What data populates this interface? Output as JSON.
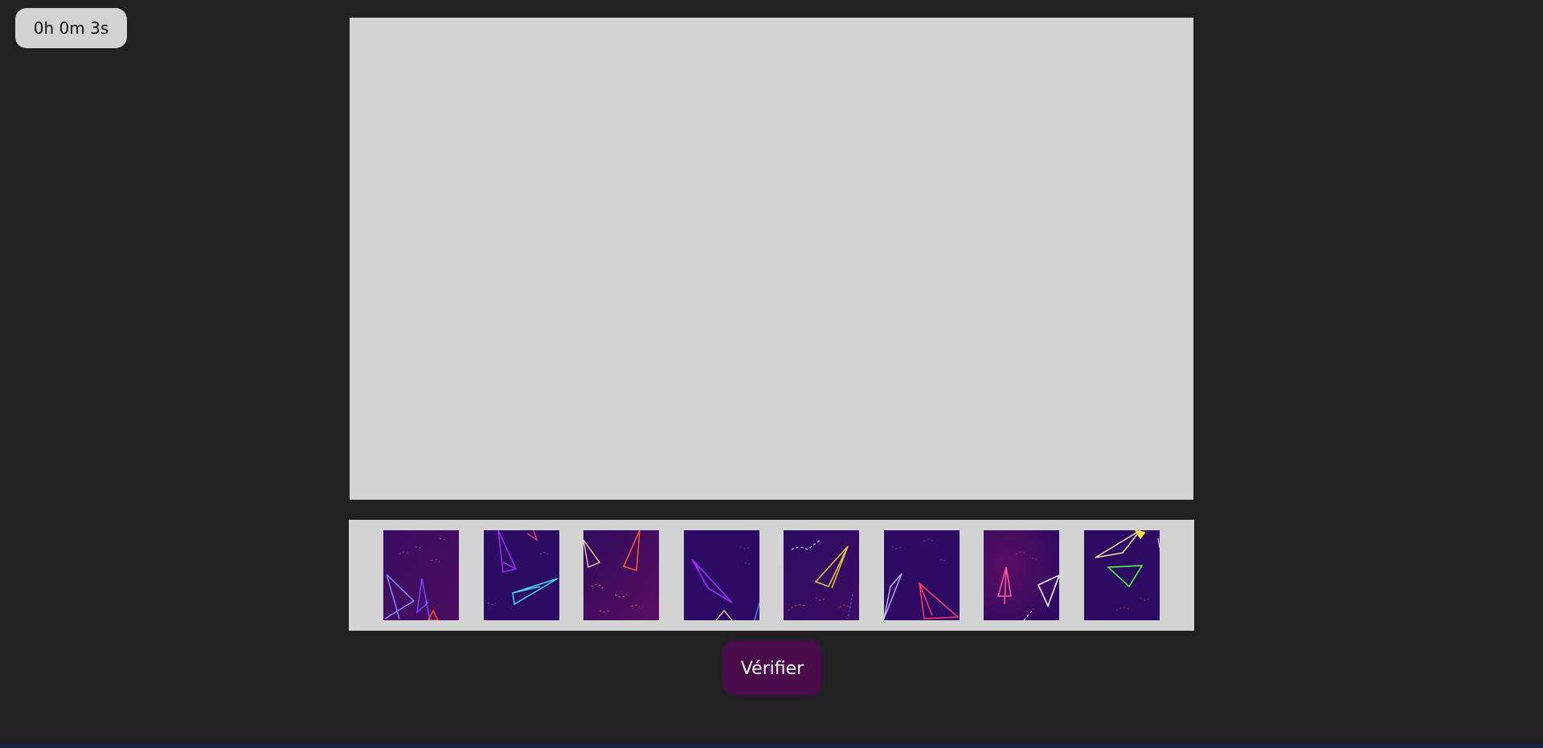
{
  "timer": {
    "text": "0h 0m 3s"
  },
  "actions": {
    "verify_label": "Vérifier"
  },
  "colors": {
    "background": "#212121",
    "board": "#d3d3d3",
    "tray": "#d3d3d3",
    "timer_bg": "#d3d3d3",
    "verify_bg": "#4a0b4a",
    "piece_bg_1": "#2b0a5e",
    "piece_bg_2": "#4a0c63"
  },
  "tray": {
    "piece_count": 8
  }
}
